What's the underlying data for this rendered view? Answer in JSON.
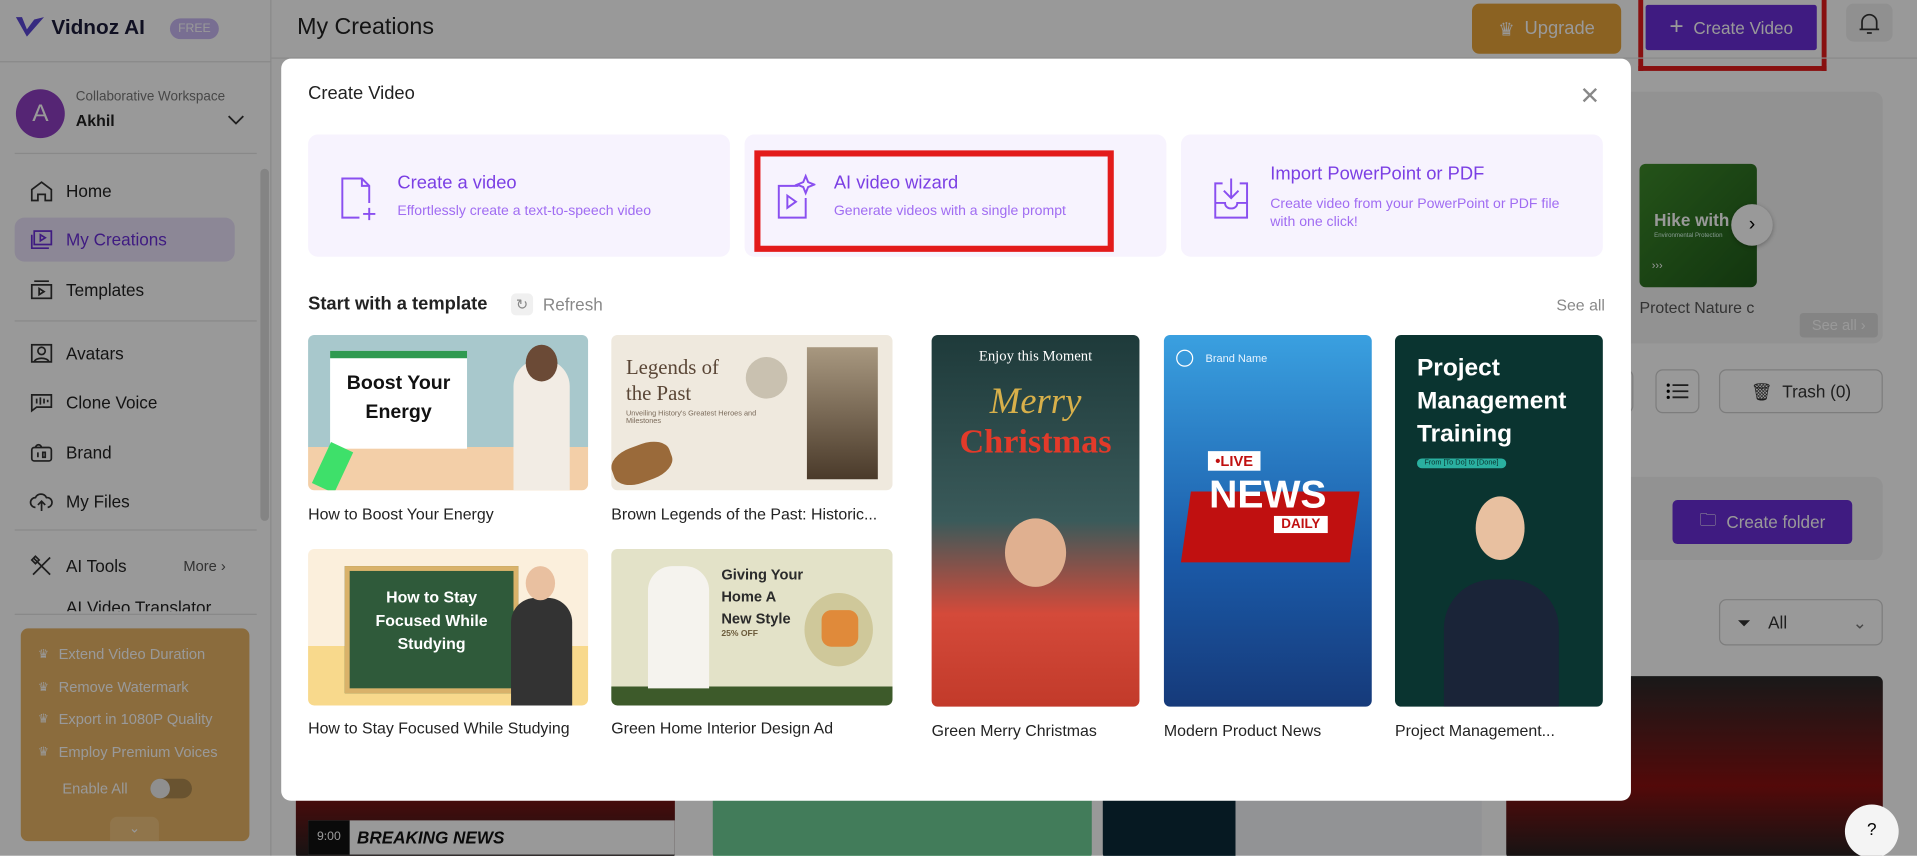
{
  "app": {
    "name": "Vidnoz AI",
    "plan_badge": "FREE"
  },
  "workspace": {
    "label": "Collaborative Workspace",
    "user": "Akhil",
    "avatar_letter": "A"
  },
  "sidebar": {
    "items": [
      {
        "label": "Home"
      },
      {
        "label": "My Creations"
      },
      {
        "label": "Templates"
      },
      {
        "label": "Avatars"
      },
      {
        "label": "Clone Voice"
      },
      {
        "label": "Brand"
      },
      {
        "label": "My Files"
      },
      {
        "label": "AI Tools"
      },
      {
        "label": "AI Video Translator"
      }
    ],
    "more_label": "More",
    "promo": {
      "items": [
        "Extend Video Duration",
        "Remove Watermark",
        "Export in 1080P Quality",
        "Employ Premium Voices"
      ],
      "enable_all": "Enable All",
      "enable_all_on": false
    }
  },
  "header": {
    "title": "My Creations",
    "upgrade": "Upgrade",
    "create_video": "Create Video"
  },
  "background": {
    "featured_title": "Hike with",
    "featured_sub": "Environmental Protection",
    "featured_caption": "Protect Nature c",
    "see_all": "See all",
    "trash": "Trash (0)",
    "create_folder": "Create folder",
    "filter": "All",
    "breaking_news": "BREAKING NEWS",
    "time": "9:00"
  },
  "modal": {
    "title": "Create Video",
    "options": [
      {
        "title": "Create a video",
        "subtitle": "Effortlessly create a text-to-speech video"
      },
      {
        "title": "AI video wizard",
        "subtitle": "Generate videos with a single prompt"
      },
      {
        "title": "Import PowerPoint or PDF",
        "subtitle": "Create video from your PowerPoint or PDF file with one click!"
      }
    ],
    "section_title": "Start with a template",
    "refresh": "Refresh",
    "see_all": "See all",
    "templates": [
      {
        "label": "How to Boost Your Energy",
        "art": "Boost Your Energy"
      },
      {
        "label": "Brown Legends of the Past: Historic...",
        "art": "Legends of the Past",
        "art_sub": "Unveiling History's Greatest Heroes and Milestones"
      },
      {
        "label": "How to Stay Focused While Studying",
        "art": "How to Stay Focused While Studying"
      },
      {
        "label": "Green Home Interior Design Ad",
        "art": "Giving Your Home A New Style",
        "art_sub": "25% OFF"
      },
      {
        "label": "Green Merry Christmas",
        "art_top": "Enjoy this Moment",
        "art": "Merry",
        "art2": "Christmas"
      },
      {
        "label": "Modern Product News",
        "art_top": "Brand Name",
        "art": "NEWS",
        "art_live": "•LIVE",
        "art2": "DAILY"
      },
      {
        "label": "Project Management...",
        "art": "Project Management Training",
        "art_sub": "From [To Do] to [Done]"
      }
    ]
  },
  "colors": {
    "accent": "#6a2ed8",
    "highlight": "#e31b1b",
    "upgrade": "#e8a33a"
  }
}
